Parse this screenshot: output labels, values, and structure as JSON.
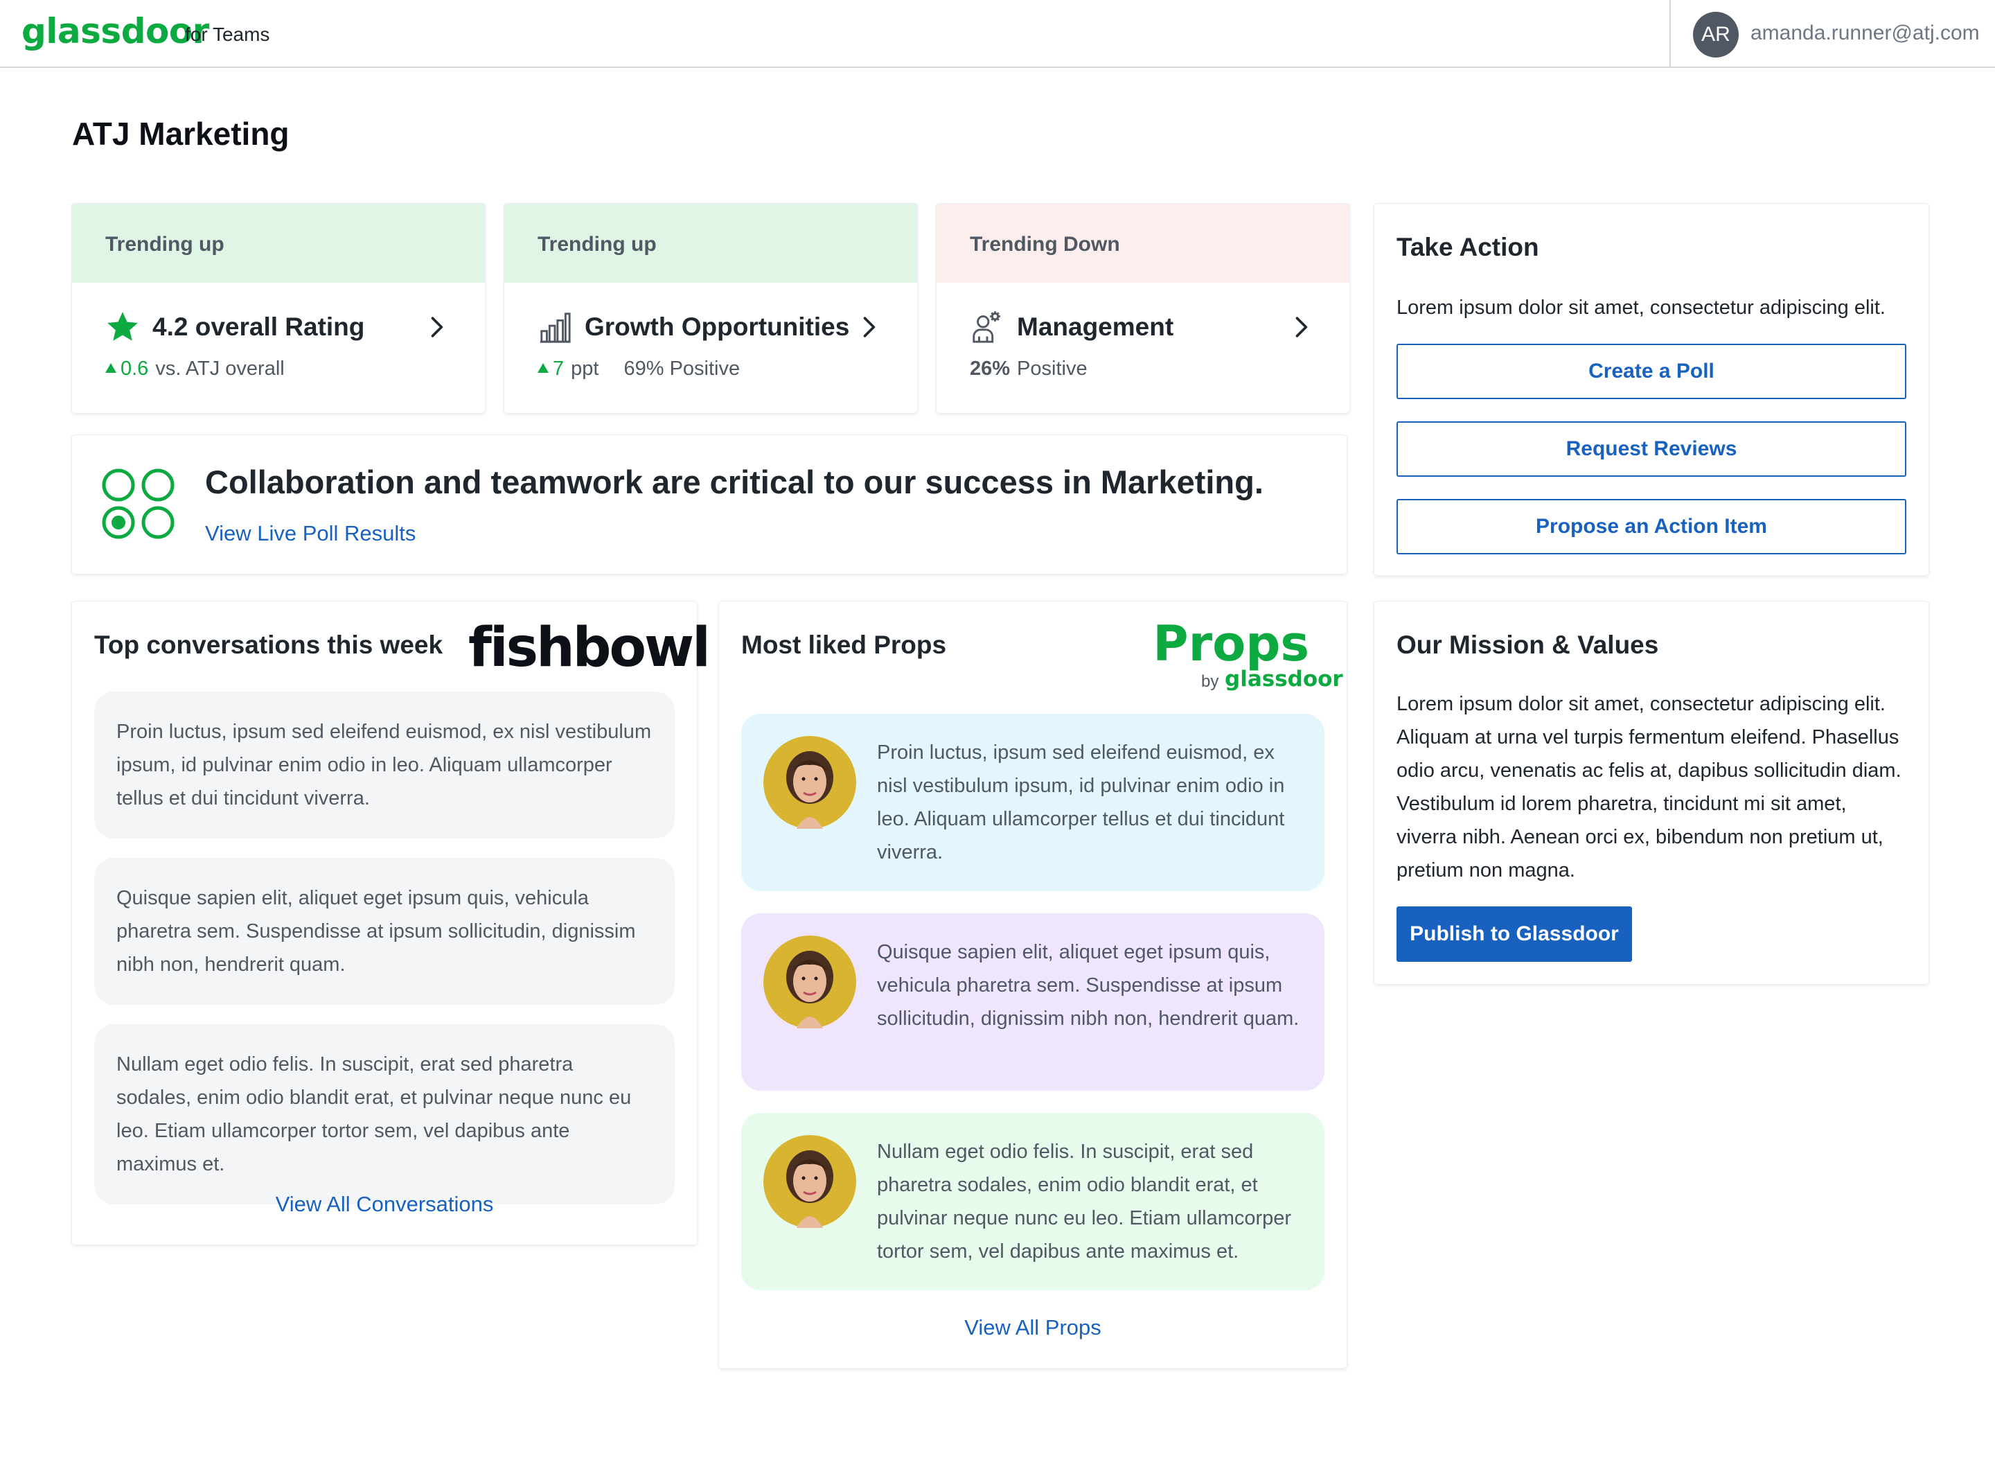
{
  "header": {
    "logo": "glassdoor",
    "logo_sub": "for Teams",
    "user_initials": "AR",
    "user_email": "amanda.runner@atj.com"
  },
  "page_title": "ATJ Marketing",
  "trends": [
    {
      "head": "Trending up",
      "label": "4.2 overall Rating",
      "icon": "star-icon",
      "delta": "0.6",
      "foot": "vs. ATJ overall"
    },
    {
      "head": "Trending up",
      "label": "Growth Opportunities",
      "icon": "bar-chart-icon",
      "delta": "7",
      "unit": "ppt",
      "foot": "69% Positive"
    },
    {
      "head": "Trending Down",
      "label": "Management",
      "icon": "people-gear-icon",
      "pct": "26%",
      "foot": "Positive"
    }
  ],
  "poll": {
    "question": "Collaboration and teamwork are critical to our success in Marketing.",
    "link": "View Live Poll Results"
  },
  "take_action": {
    "title": "Take Action",
    "text": "Lorem ipsum dolor sit amet, consectetur adipiscing elit.",
    "buttons": [
      "Create a Poll",
      "Request Reviews",
      "Propose an Action Item"
    ]
  },
  "fishbowl": {
    "title": "Top conversations this week",
    "logo": "fishbowl",
    "items": [
      "Proin luctus, ipsum sed eleifend euismod, ex nisl vestibulum ipsum, id pulvinar enim odio in leo. Aliquam ullamcorper tellus et dui tincidunt viverra.",
      "Quisque sapien elit, aliquet eget ipsum quis, vehicula pharetra sem. Suspendisse at ipsum sollicitudin, dignissim nibh non, hendrerit quam.",
      "Nullam eget odio felis. In suscipit, erat sed pharetra sodales, enim odio blandit erat, et pulvinar neque nunc eu leo. Etiam ullamcorper tortor sem, vel dapibus ante maximus et."
    ],
    "link": "View All Conversations"
  },
  "props": {
    "title": "Most liked Props",
    "logo": "Props",
    "logo_by": "by",
    "logo_brand": "glassdoor",
    "items": [
      {
        "text": "Proin luctus, ipsum sed eleifend euismod, ex nisl vestibulum ipsum, id pulvinar enim odio in leo. Aliquam ullamcorper tellus et dui tincidunt viverra.",
        "color": "#e3f6fd"
      },
      {
        "text": "Quisque sapien elit, aliquet eget ipsum quis, vehicula pharetra sem. Suspendisse at ipsum sollicitudin, dignissim nibh non, hendrerit quam.",
        "color": "#efe6fd"
      },
      {
        "text": "Nullam eget odio felis. In suscipit, erat sed pharetra sodales, enim odio blandit erat, et pulvinar neque nunc eu leo. Etiam ullamcorper tortor sem, vel dapibus ante maximus et.",
        "color": "#e6fbec"
      }
    ],
    "link": "View All Props"
  },
  "mission": {
    "title": "Our Mission & Values",
    "text": "Lorem ipsum dolor sit amet, consectetur adipiscing elit. Aliquam at urna vel turpis fermentum eleifend. Phasellus odio arcu, venenatis ac felis at, dapibus sollicitudin diam. Vestibulum id lorem pharetra, tincidunt mi sit amet, viverra nibh. Aenean orci ex, bibendum non pretium ut, pretium non magna.",
    "button": "Publish to Glassdoor"
  },
  "colors": {
    "brand_green": "#0caa41",
    "link_blue": "#1861bf",
    "trend_up_bg": "#dff5e6",
    "trend_down_bg": "#fdeeee"
  }
}
